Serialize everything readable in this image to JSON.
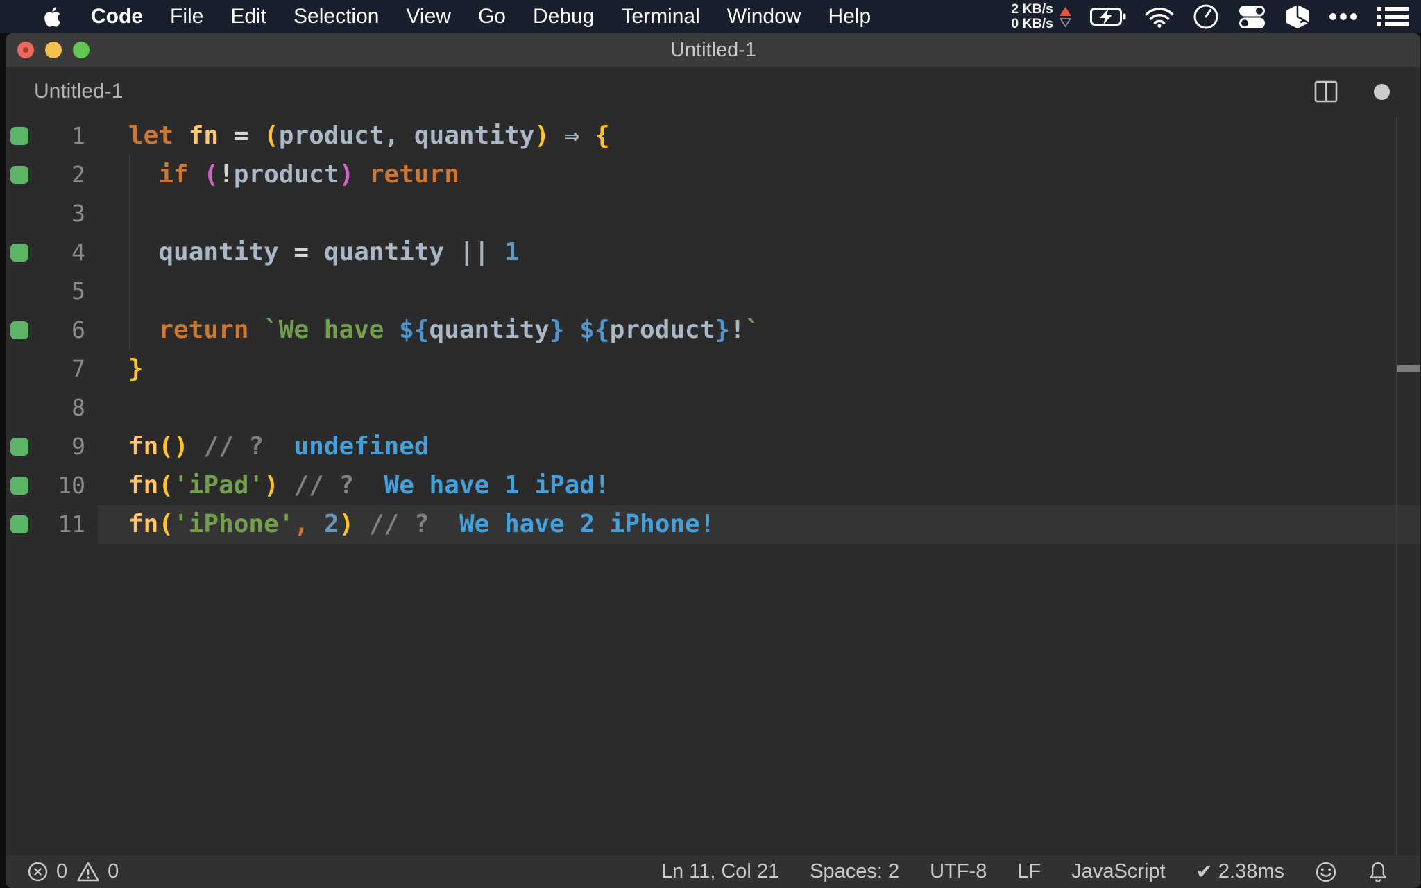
{
  "colors": {
    "menu_bar_bg": "#1a1f2e",
    "title_bar_bg": "#3b3b3b",
    "editor_bg": "#2b2b2b",
    "status_bar_bg": "#313132",
    "current_line_bg": "#343434",
    "gutter_mark_green": "#5cb567",
    "line_number_gray": "#8b8b8b",
    "traffic_red": "#ed6a5f",
    "traffic_yellow": "#f5bf4f",
    "traffic_green": "#62c554",
    "net_up_triangle": "#e0584a",
    "quokka_output_blue": "#459fdb",
    "token": {
      "kw": "#cc7832",
      "fn": "#ffc66d",
      "var": "#a9b7c6",
      "op": "#d6d6d6",
      "p1": "#ffc424",
      "p2": "#d564cf",
      "num": "#6897bb",
      "str": "#73a04f",
      "interp": "#4e94ce",
      "cmt": "#808080",
      "out": "#459fdb",
      "txt": "#d4d4d4"
    }
  },
  "menu_bar": {
    "apple_icon": "apple-icon",
    "items": [
      "Code",
      "File",
      "Edit",
      "Selection",
      "View",
      "Go",
      "Debug",
      "Terminal",
      "Window",
      "Help"
    ],
    "status": {
      "net_up": "2 KB/s",
      "net_down": "0 KB/s",
      "icons": [
        "upload-triangle-icon",
        "download-triangle-icon",
        "battery-charging-icon",
        "wifi-icon",
        "clock-icon",
        "toggle-switches-icon",
        "cube-icon",
        "overflow-dots-icon",
        "list-icon"
      ]
    }
  },
  "window": {
    "title": "Untitled-1"
  },
  "editor_header": {
    "label": "Untitled-1",
    "icons": [
      "split-editor-icon",
      "unsaved-dot-icon"
    ]
  },
  "editor": {
    "language_note": "JavaScript with Quokka inline output",
    "lines": [
      {
        "n": "1",
        "mark": true,
        "current": false,
        "segs": [
          [
            "kw",
            "let "
          ],
          [
            "fn",
            "fn"
          ],
          [
            "op",
            " = "
          ],
          [
            "p1",
            "("
          ],
          [
            "var",
            "product"
          ],
          [
            "var",
            ", "
          ],
          [
            "var",
            "quantity"
          ],
          [
            "p1",
            ")"
          ],
          [
            "var",
            " ⇒ "
          ],
          [
            "p1",
            "{"
          ]
        ]
      },
      {
        "n": "2",
        "mark": true,
        "current": false,
        "segs": [
          [
            "txt",
            "  "
          ],
          [
            "kw",
            "if"
          ],
          [
            "txt",
            " "
          ],
          [
            "p2",
            "("
          ],
          [
            "op",
            "!"
          ],
          [
            "var",
            "product"
          ],
          [
            "p2",
            ")"
          ],
          [
            "txt",
            " "
          ],
          [
            "kw",
            "return"
          ]
        ]
      },
      {
        "n": "3",
        "mark": false,
        "current": false,
        "segs": []
      },
      {
        "n": "4",
        "mark": true,
        "current": false,
        "segs": [
          [
            "txt",
            "  "
          ],
          [
            "var",
            "quantity"
          ],
          [
            "op",
            " = "
          ],
          [
            "var",
            "quantity"
          ],
          [
            "var",
            " || "
          ],
          [
            "num",
            "1"
          ]
        ]
      },
      {
        "n": "5",
        "mark": false,
        "current": false,
        "segs": []
      },
      {
        "n": "6",
        "mark": true,
        "current": false,
        "segs": [
          [
            "txt",
            "  "
          ],
          [
            "kw",
            "return"
          ],
          [
            "txt",
            " "
          ],
          [
            "str",
            "`We have "
          ],
          [
            "interp",
            "${"
          ],
          [
            "var",
            "quantity"
          ],
          [
            "interp",
            "}"
          ],
          [
            "str",
            " "
          ],
          [
            "interp",
            "${"
          ],
          [
            "var",
            "product"
          ],
          [
            "interp",
            "}"
          ],
          [
            "var",
            "!"
          ],
          [
            "str",
            "`"
          ]
        ]
      },
      {
        "n": "7",
        "mark": false,
        "current": false,
        "segs": [
          [
            "p1",
            "}"
          ]
        ]
      },
      {
        "n": "8",
        "mark": false,
        "current": false,
        "segs": []
      },
      {
        "n": "9",
        "mark": true,
        "current": false,
        "segs": [
          [
            "fn",
            "fn"
          ],
          [
            "p1",
            "()"
          ],
          [
            "txt",
            " "
          ],
          [
            "cmt",
            "// ?"
          ],
          [
            "txt",
            "  "
          ],
          [
            "out",
            "undefined"
          ]
        ]
      },
      {
        "n": "10",
        "mark": true,
        "current": false,
        "segs": [
          [
            "fn",
            "fn"
          ],
          [
            "p1",
            "("
          ],
          [
            "str",
            "'iPad'"
          ],
          [
            "p1",
            ")"
          ],
          [
            "txt",
            " "
          ],
          [
            "cmt",
            "// ?"
          ],
          [
            "txt",
            "  "
          ],
          [
            "out",
            "We have 1 iPad!"
          ]
        ]
      },
      {
        "n": "11",
        "mark": true,
        "current": true,
        "segs": [
          [
            "fn",
            "fn"
          ],
          [
            "p1",
            "("
          ],
          [
            "str",
            "'iPhone'"
          ],
          [
            "kw",
            ","
          ],
          [
            "txt",
            " "
          ],
          [
            "num",
            "2"
          ],
          [
            "p1",
            ")"
          ],
          [
            "txt",
            " "
          ],
          [
            "cmt",
            "// ?"
          ],
          [
            "txt",
            "  "
          ],
          [
            "out",
            "We have 2 iPhone!"
          ]
        ]
      }
    ]
  },
  "status_bar": {
    "errors": "0",
    "warnings": "0",
    "cursor_position": "Ln 11, Col 21",
    "indentation": "Spaces: 2",
    "encoding": "UTF-8",
    "eol": "LF",
    "language": "JavaScript",
    "quokka_check": "✔",
    "quokka_time": "2.38ms",
    "icons": [
      "error-circle-icon",
      "warning-triangle-icon",
      "check-icon",
      "smiley-icon",
      "bell-icon"
    ]
  }
}
